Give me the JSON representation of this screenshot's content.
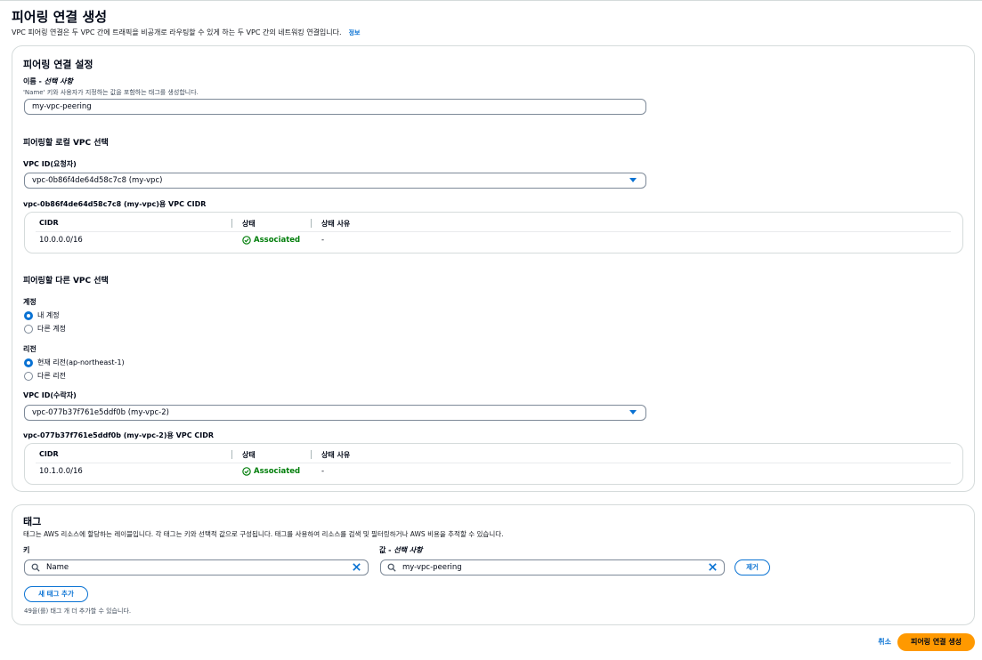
{
  "page": {
    "title": "피어링 연결 생성",
    "description": "VPC 피어링 연결은 두 VPC 간에 트래픽을 비공개로 라우팅할 수 있게 하는 두 VPC 간의 네트워킹 연결입니다.",
    "info_link": "정보"
  },
  "settings": {
    "heading": "피어링 연결 설정",
    "name_label": "이름 - ",
    "name_optional": "선택 사항",
    "name_hint": "'Name' 키와 사용자가 지정하는 값을 포함하는 태그를 생성합니다.",
    "name_value": "my-vpc-peering",
    "local_heading": "피어링할 로컬 VPC 선택",
    "requester_label": "VPC ID(요청자)",
    "requester_value": "vpc-0b86f4de64d58c7c8 (my-vpc)",
    "requester_cidr_heading": "vpc-0b86f4de64d58c7c8 (my-vpc)용 VPC CIDR",
    "cidr_table_headers": [
      "CIDR",
      "상태",
      "상태 사유"
    ],
    "requester_cidr_rows": [
      {
        "cidr": "10.0.0.0/16",
        "status": "Associated",
        "reason": "-"
      }
    ],
    "other_heading": "피어링할 다른 VPC 선택",
    "account_label": "계정",
    "account_options": [
      {
        "label": "내 계정",
        "selected": true
      },
      {
        "label": "다른 계정",
        "selected": false
      }
    ],
    "region_label": "리전",
    "region_options": [
      {
        "label": "현재 리전(ap-northeast-1)",
        "selected": true
      },
      {
        "label": "다른 리전",
        "selected": false
      }
    ],
    "accepter_label": "VPC ID(수락자)",
    "accepter_value": "vpc-077b37f761e5ddf0b (my-vpc-2)",
    "accepter_cidr_heading": "vpc-077b37f761e5ddf0b (my-vpc-2)용 VPC CIDR",
    "accepter_cidr_rows": [
      {
        "cidr": "10.1.0.0/16",
        "status": "Associated",
        "reason": "-"
      }
    ]
  },
  "tags": {
    "heading": "태그",
    "description": "태그는 AWS 리소스에 할당하는 레이블입니다. 각 태그는 키와 선택적 값으로 구성됩니다. 태그를 사용하여 리소스를 검색 및 필터링하거나 AWS 비용을 추적할 수 있습니다.",
    "key_label": "키",
    "value_label": "값 - ",
    "value_optional": "선택 사항",
    "key_value": "Name",
    "value_value": "my-vpc-peering",
    "remove_label": "제거",
    "add_label": "새 태그 추가",
    "remaining_hint": "49을(를) 태그 개 더 추가할 수 있습니다."
  },
  "footer": {
    "cancel": "취소",
    "submit": "피어링 연결 생성"
  },
  "colors": {
    "accent": "#0972d3",
    "primary_button": "#ff9900",
    "success": "#037f0c"
  },
  "icons": [
    "info-link",
    "caret-down-icon",
    "check-circle-icon",
    "search-icon",
    "clear-icon"
  ]
}
